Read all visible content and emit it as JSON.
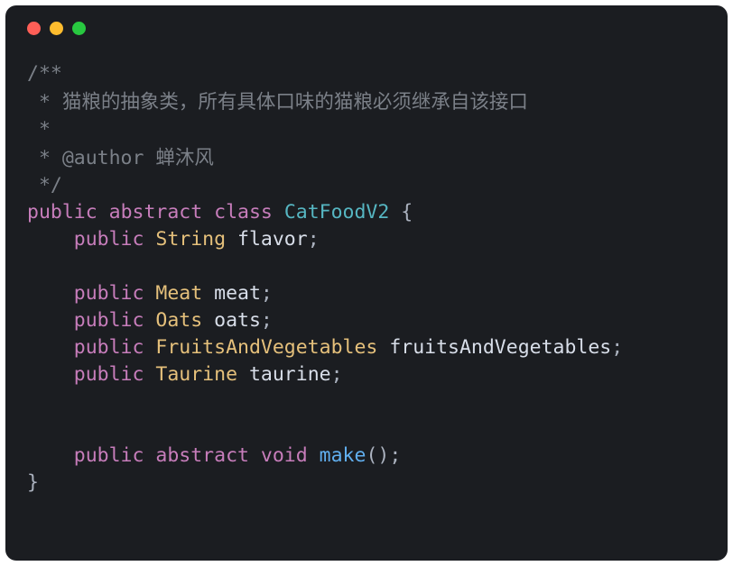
{
  "window": {
    "traffic": {
      "close": "#ff5f57",
      "minimize": "#febc2e",
      "zoom": "#28c840"
    }
  },
  "code": {
    "c1": "/**",
    "c2_prefix": " * ",
    "c2_text": "猫粮的抽象类，所有具体口味的猫粮必须继承自该接口",
    "c3": " *",
    "c4_prefix": " * @author ",
    "c4_text": "蝉沐风",
    "c5": " */",
    "kw_public": "public",
    "kw_abstract": "abstract",
    "kw_class": "class",
    "kw_void": "void",
    "sp": " ",
    "type_CatFoodV2": "CatFoodV2",
    "type_String": "String",
    "type_Meat": "Meat",
    "type_Oats": "Oats",
    "type_FAV": "FruitsAndVegetables",
    "type_Taurine": "Taurine",
    "id_flavor": "flavor",
    "id_meat": "meat",
    "id_oats": "oats",
    "id_fav": "fruitsAndVegetables",
    "id_taurine": "taurine",
    "fn_make": "make",
    "lbrace": " {",
    "rbrace": "}",
    "semi": ";",
    "parens": "();",
    "indent": "    "
  }
}
